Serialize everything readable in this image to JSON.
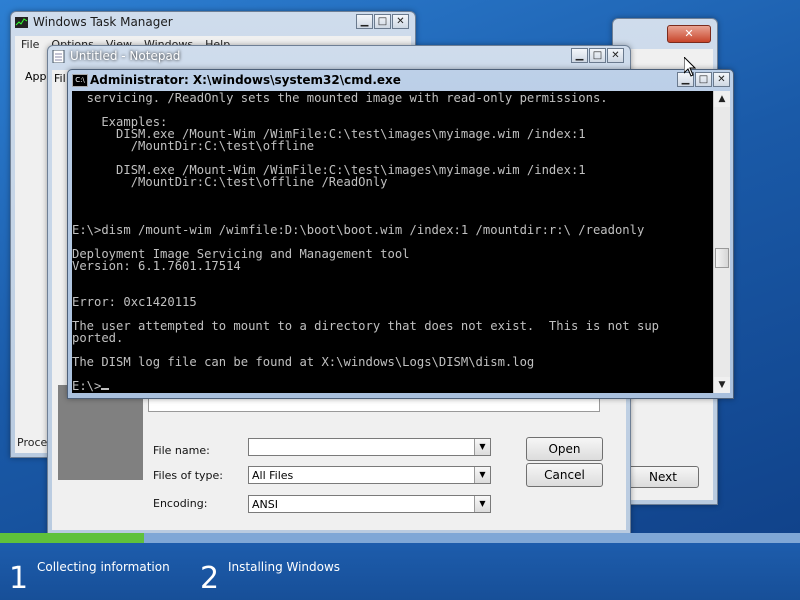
{
  "setup": {
    "close_label": "✕",
    "next_label": "Next"
  },
  "taskmgr": {
    "title": "Windows Task Manager",
    "menu": [
      "File",
      "Options",
      "View",
      "Windows",
      "Help"
    ],
    "tab_partial": "App",
    "status_partial": "Proces"
  },
  "notepad": {
    "title": "Untitled - Notepad",
    "menu_partial": "Fil"
  },
  "file_dialog": {
    "file_name_label": "File name:",
    "file_name_value": "",
    "files_of_type_label": "Files of type:",
    "files_of_type_value": "All Files",
    "encoding_label": "Encoding:",
    "encoding_value": "ANSI",
    "open_label": "Open",
    "cancel_label": "Cancel"
  },
  "cmd": {
    "title": "Administrator: X:\\windows\\system32\\cmd.exe",
    "icon_text": "C:\\",
    "lines": [
      "  servicing. /ReadOnly sets the mounted image with read-only permissions.",
      "",
      "    Examples:",
      "      DISM.exe /Mount-Wim /WimFile:C:\\test\\images\\myimage.wim /index:1",
      "        /MountDir:C:\\test\\offline",
      "",
      "      DISM.exe /Mount-Wim /WimFile:C:\\test\\images\\myimage.wim /index:1",
      "        /MountDir:C:\\test\\offline /ReadOnly",
      "",
      "",
      "",
      "E:\\>dism /mount-wim /wimfile:D:\\boot\\boot.wim /index:1 /mountdir:r:\\ /readonly",
      "",
      "Deployment Image Servicing and Management tool",
      "Version: 6.1.7601.17514",
      "",
      "",
      "Error: 0xc1420115",
      "",
      "The user attempted to mount to a directory that does not exist.  This is not sup",
      "ported.",
      "",
      "The DISM log file can be found at X:\\windows\\Logs\\DISM\\dism.log",
      ""
    ],
    "prompt": "E:\\>"
  },
  "setup_progress": {
    "fraction": 0.18,
    "steps": [
      {
        "number": "1",
        "label": "Collecting information"
      },
      {
        "number": "2",
        "label": "Installing Windows"
      }
    ]
  },
  "colors": {
    "progress_fill": "#5fc13b",
    "console_bg": "#000000",
    "console_text": "#c0c0c0"
  }
}
